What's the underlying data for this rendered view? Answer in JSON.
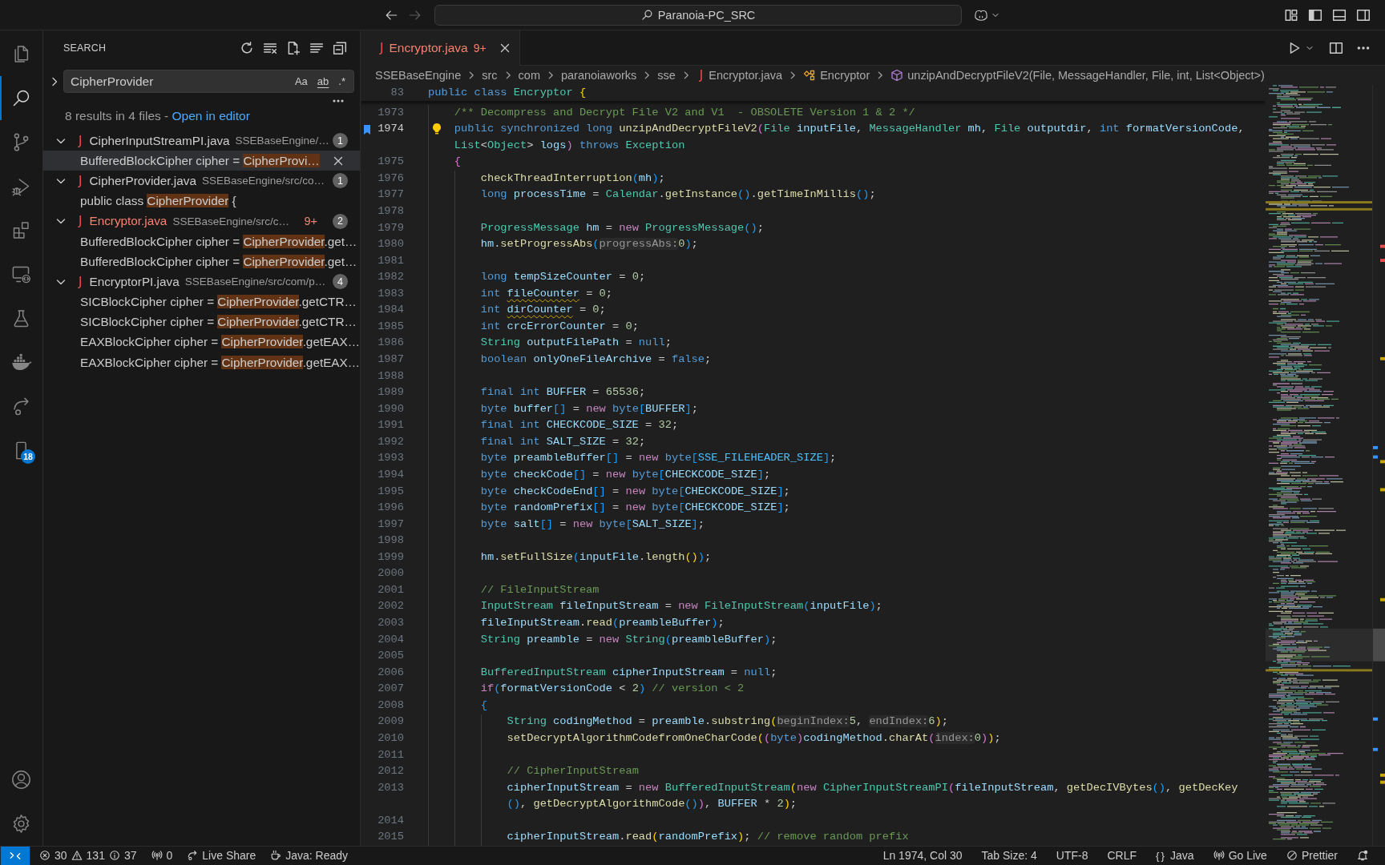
{
  "title_bar": {
    "navigation": [
      {
        "kind": "back",
        "disabled": false
      },
      {
        "kind": "forward",
        "disabled": true
      }
    ],
    "command_center": "Paranoia-PC_SRC"
  },
  "activity_bar": {
    "items": [
      {
        "kind": "explorer",
        "selected": false
      },
      {
        "kind": "search",
        "selected": true
      },
      {
        "kind": "scm",
        "selected": false
      },
      {
        "kind": "debug",
        "selected": false
      },
      {
        "kind": "extensions",
        "selected": false
      },
      {
        "kind": "remote",
        "selected": false
      },
      {
        "kind": "testing",
        "selected": false
      },
      {
        "kind": "docker",
        "selected": false
      },
      {
        "kind": "liveshare",
        "selected": false
      },
      {
        "kind": "bookmarks",
        "selected": false,
        "badge": "18"
      }
    ],
    "bottom": [
      {
        "kind": "accounts"
      },
      {
        "kind": "settings"
      }
    ]
  },
  "sidebar": {
    "title": "SEARCH",
    "query": "CipherProvider",
    "toggles": [
      {
        "kind": "case",
        "label": "Aa",
        "on": false
      },
      {
        "kind": "word",
        "label": "ab",
        "on": false
      },
      {
        "kind": "regex",
        "label": ".*",
        "on": false
      }
    ],
    "summary": "8 results in 4 files -",
    "summary_link": "Open in editor",
    "results": [
      {
        "glyph": "J",
        "file": "CipherInputStreamPI.java",
        "path": "SSEBaseEngine/…",
        "count": "1",
        "expanded": true,
        "matches": [
          {
            "before": "BufferedBlockCipher cipher = ",
            "match": "CipherProvi…",
            "selected": true
          }
        ]
      },
      {
        "glyph": "J",
        "file": "CipherProvider.java",
        "path": "SSEBaseEngine/src/co…",
        "count": "1",
        "expanded": true,
        "matches": [
          {
            "before": "public class ",
            "match": "CipherProvider",
            "after": " {",
            "selected": false
          }
        ]
      },
      {
        "glyph": "J",
        "file": "Encryptor.java",
        "path": "SSEBaseEngine/src/c…",
        "problems": "9+",
        "count": "2",
        "expanded": true,
        "matches": [
          {
            "before": "BufferedBlockCipher cipher = ",
            "match": "CipherProvider",
            "after": ".get…",
            "selected": false
          },
          {
            "before": "BufferedBlockCipher cipher = ",
            "match": "CipherProvider",
            "after": ".get…",
            "selected": false
          }
        ]
      },
      {
        "glyph": "J",
        "file": "EncryptorPI.java",
        "path": "SSEBaseEngine/src/com/p…",
        "count": "4",
        "expanded": true,
        "matches": [
          {
            "before": "SICBlockCipher cipher = ",
            "match": "CipherProvider",
            "after": ".getCTR…",
            "selected": false
          },
          {
            "before": "SICBlockCipher cipher = ",
            "match": "CipherProvider",
            "after": ".getCTR…",
            "selected": false
          },
          {
            "before": "EAXBlockCipher cipher = ",
            "match": "CipherProvider",
            "after": ".getEAX…",
            "selected": false
          },
          {
            "before": "EAXBlockCipher cipher = ",
            "match": "CipherProvider",
            "after": ".getEAX…",
            "selected": false
          }
        ]
      }
    ]
  },
  "editor": {
    "tabs": [
      {
        "glyph": "J",
        "name": "Encryptor.java",
        "problems": "9+",
        "selected": true
      }
    ],
    "breadcrumbs": [
      {
        "kind": "folder",
        "label": "SSEBaseEngine"
      },
      {
        "kind": "folder",
        "label": "src"
      },
      {
        "kind": "folder",
        "label": "com"
      },
      {
        "kind": "folder",
        "label": "paranoiaworks"
      },
      {
        "kind": "folder",
        "label": "sse"
      },
      {
        "kind": "file",
        "glyph": "J",
        "label": "Encryptor.java"
      },
      {
        "kind": "class",
        "label": "Encryptor"
      },
      {
        "kind": "method",
        "label": "unzipAndDecryptFileV2(File, MessageHandler, File, int, List<Object>)"
      }
    ],
    "sticky": {
      "number": "83",
      "tokens": [
        {
          "text": "public class ",
          "kind": "keyword"
        },
        {
          "text": "Encryptor ",
          "kind": "type"
        },
        {
          "text": "{",
          "kind": "bracket1"
        }
      ]
    },
    "lines": [
      {
        "number": "1973",
        "current": false,
        "bookmarked": false,
        "tokens": [
          {
            "text": "    /** Decompress and Decrypt File V2 and V1  - OBSOLETE Version 1 & 2 */",
            "kind": "comment"
          }
        ]
      },
      {
        "number": "1974",
        "current": true,
        "bookmarked": true,
        "tokens": [
          {
            "text": "    public synchronized long ",
            "kind": "keyword"
          },
          {
            "text": "unzipAndDecryptFileV2",
            "kind": "function"
          },
          {
            "text": "(",
            "kind": "bracket2"
          },
          {
            "text": "File ",
            "kind": "type"
          },
          {
            "text": "inputFile",
            "kind": "variable"
          },
          {
            "text": ", ",
            "kind": "plain"
          },
          {
            "text": "MessageHandler ",
            "kind": "type"
          },
          {
            "text": "mh",
            "kind": "variable"
          },
          {
            "text": ", ",
            "kind": "plain"
          },
          {
            "text": "File ",
            "kind": "type"
          },
          {
            "text": "outputdir",
            "kind": "variable"
          },
          {
            "text": ", ",
            "kind": "plain"
          },
          {
            "text": "int ",
            "kind": "keyword"
          },
          {
            "text": "formatVersionCode",
            "kind": "variable"
          },
          {
            "text": ",",
            "kind": "plain"
          }
        ],
        "wrapped_tokens": [
          {
            "text": "List",
            "kind": "type"
          },
          {
            "text": "<",
            "kind": "plain"
          },
          {
            "text": "Object",
            "kind": "type"
          },
          {
            "text": "> ",
            "kind": "plain"
          },
          {
            "text": "logs",
            "kind": "variable"
          },
          {
            "text": ")",
            "kind": "bracket2"
          },
          {
            "text": " throws ",
            "kind": "keyword"
          },
          {
            "text": "Exception",
            "kind": "type"
          }
        ]
      },
      {
        "number": "1975",
        "current": false,
        "bookmarked": false,
        "tokens": [
          {
            "text": "    {",
            "kind": "bracket2"
          }
        ]
      },
      {
        "number": "1976",
        "current": false,
        "bookmarked": false,
        "tokens": [
          {
            "text": "        checkThreadInterruption",
            "kind": "function"
          },
          {
            "text": "(",
            "kind": "bracket3"
          },
          {
            "text": "mh",
            "kind": "variable"
          },
          {
            "text": ")",
            "kind": "bracket3"
          },
          {
            "text": ";",
            "kind": "plain"
          }
        ]
      },
      {
        "number": "1977",
        "current": false,
        "bookmarked": false,
        "tokens": [
          {
            "text": "        long ",
            "kind": "keyword"
          },
          {
            "text": "processTime",
            "kind": "variable"
          },
          {
            "text": " = ",
            "kind": "plain"
          },
          {
            "text": "Calendar",
            "kind": "type"
          },
          {
            "text": ".",
            "kind": "plain"
          },
          {
            "text": "getInstance",
            "kind": "function"
          },
          {
            "text": "()",
            "kind": "bracket3"
          },
          {
            "text": ".",
            "kind": "plain"
          },
          {
            "text": "getTimeInMillis",
            "kind": "function"
          },
          {
            "text": "()",
            "kind": "bracket3"
          },
          {
            "text": ";",
            "kind": "plain"
          }
        ]
      },
      {
        "number": "1978",
        "current": false,
        "bookmarked": false
      },
      {
        "number": "1979",
        "current": false,
        "bookmarked": false,
        "tokens": [
          {
            "text": "        ProgressMessage ",
            "kind": "type"
          },
          {
            "text": "hm",
            "kind": "variable"
          },
          {
            "text": " = ",
            "kind": "plain"
          },
          {
            "text": "new ",
            "kind": "control"
          },
          {
            "text": "ProgressMessage",
            "kind": "type"
          },
          {
            "text": "()",
            "kind": "bracket3"
          },
          {
            "text": ";",
            "kind": "plain"
          }
        ]
      },
      {
        "number": "1980",
        "current": false,
        "bookmarked": false,
        "tokens": [
          {
            "text": "        hm",
            "kind": "variable"
          },
          {
            "text": ".",
            "kind": "plain"
          },
          {
            "text": "setProgressAbs",
            "kind": "function"
          },
          {
            "text": "(",
            "kind": "bracket3"
          },
          {
            "text": "progressAbs:",
            "kind": "hint"
          },
          {
            "text": "0",
            "kind": "number"
          },
          {
            "text": ")",
            "kind": "bracket3"
          },
          {
            "text": ";",
            "kind": "plain"
          }
        ]
      },
      {
        "number": "1981",
        "current": false,
        "bookmarked": false
      },
      {
        "number": "1982",
        "current": false,
        "bookmarked": false,
        "tokens": [
          {
            "text": "        long ",
            "kind": "keyword"
          },
          {
            "text": "tempSizeCounter",
            "kind": "variable"
          },
          {
            "text": " = ",
            "kind": "plain"
          },
          {
            "text": "0",
            "kind": "number"
          },
          {
            "text": ";",
            "kind": "plain"
          }
        ]
      },
      {
        "number": "1983",
        "current": false,
        "bookmarked": false,
        "tokens": [
          {
            "text": "        int ",
            "kind": "keyword"
          },
          {
            "text": "fileCounter",
            "kind": "warned"
          },
          {
            "text": " = ",
            "kind": "plain"
          },
          {
            "text": "0",
            "kind": "number"
          },
          {
            "text": ";",
            "kind": "plain"
          }
        ]
      },
      {
        "number": "1984",
        "current": false,
        "bookmarked": false,
        "tokens": [
          {
            "text": "        int ",
            "kind": "keyword"
          },
          {
            "text": "dirCounter",
            "kind": "warned"
          },
          {
            "text": " = ",
            "kind": "plain"
          },
          {
            "text": "0",
            "kind": "number"
          },
          {
            "text": ";",
            "kind": "plain"
          }
        ]
      },
      {
        "number": "1985",
        "current": false,
        "bookmarked": false,
        "tokens": [
          {
            "text": "        int ",
            "kind": "keyword"
          },
          {
            "text": "crcErrorCounter",
            "kind": "variable"
          },
          {
            "text": " = ",
            "kind": "plain"
          },
          {
            "text": "0",
            "kind": "number"
          },
          {
            "text": ";",
            "kind": "plain"
          }
        ]
      },
      {
        "number": "1986",
        "current": false,
        "bookmarked": false,
        "tokens": [
          {
            "text": "        String ",
            "kind": "type"
          },
          {
            "text": "outputFilePath",
            "kind": "variable"
          },
          {
            "text": " = ",
            "kind": "plain"
          },
          {
            "text": "null",
            "kind": "keyword"
          },
          {
            "text": ";",
            "kind": "plain"
          }
        ]
      },
      {
        "number": "1987",
        "current": false,
        "bookmarked": false,
        "tokens": [
          {
            "text": "        boolean ",
            "kind": "keyword"
          },
          {
            "text": "onlyOneFileArchive",
            "kind": "variable"
          },
          {
            "text": " = ",
            "kind": "plain"
          },
          {
            "text": "false",
            "kind": "keyword"
          },
          {
            "text": ";",
            "kind": "plain"
          }
        ]
      },
      {
        "number": "1988",
        "current": false,
        "bookmarked": false
      },
      {
        "number": "1989",
        "current": false,
        "bookmarked": false,
        "tokens": [
          {
            "text": "        final int ",
            "kind": "keyword"
          },
          {
            "text": "BUFFER",
            "kind": "variable"
          },
          {
            "text": " = ",
            "kind": "plain"
          },
          {
            "text": "65536",
            "kind": "number"
          },
          {
            "text": ";",
            "kind": "plain"
          }
        ]
      },
      {
        "number": "1990",
        "current": false,
        "bookmarked": false,
        "tokens": [
          {
            "text": "        byte ",
            "kind": "keyword"
          },
          {
            "text": "buffer",
            "kind": "variable"
          },
          {
            "text": "[]",
            "kind": "bracket3"
          },
          {
            "text": " = ",
            "kind": "plain"
          },
          {
            "text": "new ",
            "kind": "control"
          },
          {
            "text": "byte",
            "kind": "keyword"
          },
          {
            "text": "[",
            "kind": "bracket3"
          },
          {
            "text": "BUFFER",
            "kind": "variable"
          },
          {
            "text": "]",
            "kind": "bracket3"
          },
          {
            "text": ";",
            "kind": "plain"
          }
        ]
      },
      {
        "number": "1991",
        "current": false,
        "bookmarked": false,
        "tokens": [
          {
            "text": "        final int ",
            "kind": "keyword"
          },
          {
            "text": "CHECKCODE_SIZE",
            "kind": "variable"
          },
          {
            "text": " = ",
            "kind": "plain"
          },
          {
            "text": "32",
            "kind": "number"
          },
          {
            "text": ";",
            "kind": "plain"
          }
        ]
      },
      {
        "number": "1992",
        "current": false,
        "bookmarked": false,
        "tokens": [
          {
            "text": "        final int ",
            "kind": "keyword"
          },
          {
            "text": "SALT_SIZE",
            "kind": "variable"
          },
          {
            "text": " = ",
            "kind": "plain"
          },
          {
            "text": "32",
            "kind": "number"
          },
          {
            "text": ";",
            "kind": "plain"
          }
        ]
      },
      {
        "number": "1993",
        "current": false,
        "bookmarked": false,
        "tokens": [
          {
            "text": "        byte ",
            "kind": "keyword"
          },
          {
            "text": "preambleBuffer",
            "kind": "variable"
          },
          {
            "text": "[]",
            "kind": "bracket3"
          },
          {
            "text": " = ",
            "kind": "plain"
          },
          {
            "text": "new ",
            "kind": "control"
          },
          {
            "text": "byte",
            "kind": "keyword"
          },
          {
            "text": "[",
            "kind": "bracket3"
          },
          {
            "text": "SSE_FILEHEADER_SIZE",
            "kind": "constant"
          },
          {
            "text": "]",
            "kind": "bracket3"
          },
          {
            "text": ";",
            "kind": "plain"
          }
        ]
      },
      {
        "number": "1994",
        "current": false,
        "bookmarked": false,
        "tokens": [
          {
            "text": "        byte ",
            "kind": "keyword"
          },
          {
            "text": "checkCode",
            "kind": "variable"
          },
          {
            "text": "[]",
            "kind": "bracket3"
          },
          {
            "text": " = ",
            "kind": "plain"
          },
          {
            "text": "new ",
            "kind": "control"
          },
          {
            "text": "byte",
            "kind": "keyword"
          },
          {
            "text": "[",
            "kind": "bracket3"
          },
          {
            "text": "CHECKCODE_SIZE",
            "kind": "variable"
          },
          {
            "text": "]",
            "kind": "bracket3"
          },
          {
            "text": ";",
            "kind": "plain"
          }
        ]
      },
      {
        "number": "1995",
        "current": false,
        "bookmarked": false,
        "tokens": [
          {
            "text": "        byte ",
            "kind": "keyword"
          },
          {
            "text": "checkCodeEnd",
            "kind": "variable"
          },
          {
            "text": "[]",
            "kind": "bracket3"
          },
          {
            "text": " = ",
            "kind": "plain"
          },
          {
            "text": "new ",
            "kind": "control"
          },
          {
            "text": "byte",
            "kind": "keyword"
          },
          {
            "text": "[",
            "kind": "bracket3"
          },
          {
            "text": "CHECKCODE_SIZE",
            "kind": "variable"
          },
          {
            "text": "]",
            "kind": "bracket3"
          },
          {
            "text": ";",
            "kind": "plain"
          }
        ]
      },
      {
        "number": "1996",
        "current": false,
        "bookmarked": false,
        "tokens": [
          {
            "text": "        byte ",
            "kind": "keyword"
          },
          {
            "text": "randomPrefix",
            "kind": "variable"
          },
          {
            "text": "[]",
            "kind": "bracket3"
          },
          {
            "text": " = ",
            "kind": "plain"
          },
          {
            "text": "new ",
            "kind": "control"
          },
          {
            "text": "byte",
            "kind": "keyword"
          },
          {
            "text": "[",
            "kind": "bracket3"
          },
          {
            "text": "CHECKCODE_SIZE",
            "kind": "variable"
          },
          {
            "text": "]",
            "kind": "bracket3"
          },
          {
            "text": ";",
            "kind": "plain"
          }
        ]
      },
      {
        "number": "1997",
        "current": false,
        "bookmarked": false,
        "tokens": [
          {
            "text": "        byte ",
            "kind": "keyword"
          },
          {
            "text": "salt",
            "kind": "variable"
          },
          {
            "text": "[]",
            "kind": "bracket3"
          },
          {
            "text": " = ",
            "kind": "plain"
          },
          {
            "text": "new ",
            "kind": "control"
          },
          {
            "text": "byte",
            "kind": "keyword"
          },
          {
            "text": "[",
            "kind": "bracket3"
          },
          {
            "text": "SALT_SIZE",
            "kind": "variable"
          },
          {
            "text": "]",
            "kind": "bracket3"
          },
          {
            "text": ";",
            "kind": "plain"
          }
        ]
      },
      {
        "number": "1998",
        "current": false,
        "bookmarked": false
      },
      {
        "number": "1999",
        "current": false,
        "bookmarked": false,
        "tokens": [
          {
            "text": "        hm",
            "kind": "variable"
          },
          {
            "text": ".",
            "kind": "plain"
          },
          {
            "text": "setFullSize",
            "kind": "function"
          },
          {
            "text": "(",
            "kind": "bracket3"
          },
          {
            "text": "inputFile",
            "kind": "variable"
          },
          {
            "text": ".",
            "kind": "plain"
          },
          {
            "text": "length",
            "kind": "function"
          },
          {
            "text": "()",
            "kind": "bracket1"
          },
          {
            "text": ")",
            "kind": "bracket3"
          },
          {
            "text": ";",
            "kind": "plain"
          }
        ]
      },
      {
        "number": "2000",
        "current": false,
        "bookmarked": false
      },
      {
        "number": "2001",
        "current": false,
        "bookmarked": false,
        "tokens": [
          {
            "text": "        // FileInputStream",
            "kind": "comment"
          }
        ]
      },
      {
        "number": "2002",
        "current": false,
        "bookmarked": false,
        "tokens": [
          {
            "text": "        InputStream ",
            "kind": "type"
          },
          {
            "text": "fileInputStream",
            "kind": "variable"
          },
          {
            "text": " = ",
            "kind": "plain"
          },
          {
            "text": "new ",
            "kind": "control"
          },
          {
            "text": "FileInputStream",
            "kind": "type"
          },
          {
            "text": "(",
            "kind": "bracket3"
          },
          {
            "text": "inputFile",
            "kind": "variable"
          },
          {
            "text": ")",
            "kind": "bracket3"
          },
          {
            "text": ";",
            "kind": "plain"
          }
        ]
      },
      {
        "number": "2003",
        "current": false,
        "bookmarked": false,
        "tokens": [
          {
            "text": "        fileInputStream",
            "kind": "variable"
          },
          {
            "text": ".",
            "kind": "plain"
          },
          {
            "text": "read",
            "kind": "function"
          },
          {
            "text": "(",
            "kind": "bracket3"
          },
          {
            "text": "preambleBuffer",
            "kind": "variable"
          },
          {
            "text": ")",
            "kind": "bracket3"
          },
          {
            "text": ";",
            "kind": "plain"
          }
        ]
      },
      {
        "number": "2004",
        "current": false,
        "bookmarked": false,
        "tokens": [
          {
            "text": "        String ",
            "kind": "type"
          },
          {
            "text": "preamble",
            "kind": "variable"
          },
          {
            "text": " = ",
            "kind": "plain"
          },
          {
            "text": "new ",
            "kind": "control"
          },
          {
            "text": "String",
            "kind": "type"
          },
          {
            "text": "(",
            "kind": "bracket3"
          },
          {
            "text": "preambleBuffer",
            "kind": "variable"
          },
          {
            "text": ")",
            "kind": "bracket3"
          },
          {
            "text": ";",
            "kind": "plain"
          }
        ]
      },
      {
        "number": "2005",
        "current": false,
        "bookmarked": false
      },
      {
        "number": "2006",
        "current": false,
        "bookmarked": false,
        "tokens": [
          {
            "text": "        BufferedInputStream ",
            "kind": "type"
          },
          {
            "text": "cipherInputStream",
            "kind": "variable"
          },
          {
            "text": " = ",
            "kind": "plain"
          },
          {
            "text": "null",
            "kind": "keyword"
          },
          {
            "text": ";",
            "kind": "plain"
          }
        ]
      },
      {
        "number": "2007",
        "current": false,
        "bookmarked": false,
        "tokens": [
          {
            "text": "        if",
            "kind": "control"
          },
          {
            "text": "(",
            "kind": "bracket3"
          },
          {
            "text": "formatVersionCode",
            "kind": "variable"
          },
          {
            "text": " < ",
            "kind": "plain"
          },
          {
            "text": "2",
            "kind": "number"
          },
          {
            "text": ")",
            "kind": "bracket3"
          },
          {
            "text": " // version < 2",
            "kind": "comment"
          }
        ]
      },
      {
        "number": "2008",
        "current": false,
        "bookmarked": false,
        "tokens": [
          {
            "text": "        {",
            "kind": "bracket3"
          }
        ]
      },
      {
        "number": "2009",
        "current": false,
        "bookmarked": false,
        "tokens": [
          {
            "text": "            String ",
            "kind": "type"
          },
          {
            "text": "codingMethod",
            "kind": "variable"
          },
          {
            "text": " = ",
            "kind": "plain"
          },
          {
            "text": "preamble",
            "kind": "variable"
          },
          {
            "text": ".",
            "kind": "plain"
          },
          {
            "text": "substring",
            "kind": "function"
          },
          {
            "text": "(",
            "kind": "bracket1"
          },
          {
            "text": "beginIndex:",
            "kind": "hint"
          },
          {
            "text": "5",
            "kind": "number"
          },
          {
            "text": ", ",
            "kind": "plain"
          },
          {
            "text": "endIndex:",
            "kind": "hint"
          },
          {
            "text": "6",
            "kind": "number"
          },
          {
            "text": ")",
            "kind": "bracket1"
          },
          {
            "text": ";",
            "kind": "plain"
          }
        ]
      },
      {
        "number": "2010",
        "current": false,
        "bookmarked": false,
        "tokens": [
          {
            "text": "            setDecryptAlgorithmCodefromOneCharCode",
            "kind": "function"
          },
          {
            "text": "(",
            "kind": "bracket1"
          },
          {
            "text": "(",
            "kind": "bracket2"
          },
          {
            "text": "byte",
            "kind": "keyword"
          },
          {
            "text": ")",
            "kind": "bracket2"
          },
          {
            "text": "codingMethod",
            "kind": "variable"
          },
          {
            "text": ".",
            "kind": "plain"
          },
          {
            "text": "charAt",
            "kind": "function"
          },
          {
            "text": "(",
            "kind": "bracket2"
          },
          {
            "text": "index:",
            "kind": "hint"
          },
          {
            "text": "0",
            "kind": "number"
          },
          {
            "text": ")",
            "kind": "bracket2"
          },
          {
            "text": ")",
            "kind": "bracket1"
          },
          {
            "text": ";",
            "kind": "plain"
          }
        ]
      },
      {
        "number": "2011",
        "current": false,
        "bookmarked": false
      },
      {
        "number": "2012",
        "current": false,
        "bookmarked": false,
        "tokens": [
          {
            "text": "            // CipherInputStream",
            "kind": "comment"
          }
        ]
      },
      {
        "number": "2013",
        "current": false,
        "bookmarked": false,
        "tokens": [
          {
            "text": "            cipherInputStream",
            "kind": "variable"
          },
          {
            "text": " = ",
            "kind": "plain"
          },
          {
            "text": "new ",
            "kind": "control"
          },
          {
            "text": "BufferedInputStream",
            "kind": "type"
          },
          {
            "text": "(",
            "kind": "bracket1"
          },
          {
            "text": "new ",
            "kind": "control"
          },
          {
            "text": "CipherInputStreamPI",
            "kind": "type"
          },
          {
            "text": "(",
            "kind": "bracket2"
          },
          {
            "text": "fileInputStream",
            "kind": "variable"
          },
          {
            "text": ", ",
            "kind": "plain"
          },
          {
            "text": "getDecIVBytes",
            "kind": "function"
          },
          {
            "text": "()",
            "kind": "bracket3"
          },
          {
            "text": ", ",
            "kind": "plain"
          },
          {
            "text": "getDecKey",
            "kind": "function"
          }
        ],
        "wrapped_tokens": [
          {
            "text": "()",
            "kind": "bracket3"
          },
          {
            "text": ", ",
            "kind": "plain"
          },
          {
            "text": "getDecryptAlgorithmCode",
            "kind": "function"
          },
          {
            "text": "()",
            "kind": "bracket3"
          },
          {
            "text": ")",
            "kind": "bracket2"
          },
          {
            "text": ", ",
            "kind": "plain"
          },
          {
            "text": "BUFFER",
            "kind": "variable"
          },
          {
            "text": " * ",
            "kind": "plain"
          },
          {
            "text": "2",
            "kind": "number"
          },
          {
            "text": ")",
            "kind": "bracket1"
          },
          {
            "text": ";",
            "kind": "plain"
          }
        ]
      },
      {
        "number": "2014",
        "current": false,
        "bookmarked": false
      },
      {
        "number": "2015",
        "current": false,
        "bookmarked": false,
        "tokens": [
          {
            "text": "            cipherInputStream",
            "kind": "variable"
          },
          {
            "text": ".",
            "kind": "plain"
          },
          {
            "text": "read",
            "kind": "function"
          },
          {
            "text": "(",
            "kind": "bracket1"
          },
          {
            "text": "randomPrefix",
            "kind": "variable"
          },
          {
            "text": ")",
            "kind": "bracket1"
          },
          {
            "text": ";",
            "kind": "plain"
          },
          {
            "text": " // remove random prefix",
            "kind": "comment"
          }
        ]
      }
    ]
  },
  "status_bar": {
    "problems": {
      "errors": "30",
      "warnings": "131",
      "infos": "37"
    },
    "ports": "0",
    "left": [
      {
        "kind": "liveshare",
        "label": "Live Share"
      },
      {
        "kind": "java",
        "label": "Java: Ready"
      }
    ],
    "right": [
      {
        "kind": "cursor",
        "label": "Ln 1974, Col 30"
      },
      {
        "kind": "indent",
        "label": "Tab Size: 4"
      },
      {
        "kind": "encoding",
        "label": "UTF-8"
      },
      {
        "kind": "eol",
        "label": "CRLF"
      },
      {
        "kind": "language",
        "glyph": "{}",
        "label": "Java"
      },
      {
        "kind": "golive",
        "label": "Go Live"
      },
      {
        "kind": "prettier",
        "label": "Prettier"
      },
      {
        "kind": "notifications"
      }
    ]
  }
}
